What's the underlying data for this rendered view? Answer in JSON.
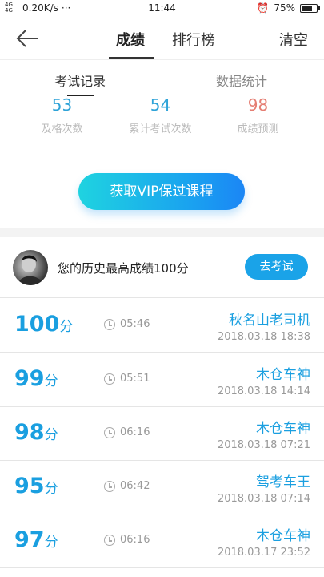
{
  "status_bar": {
    "signal": "4G 4G",
    "speed": "0.20K/s",
    "dots": "···",
    "time": "11:44",
    "battery": "75%",
    "battery_level": 0.75
  },
  "nav": {
    "tab_score": "成绩",
    "tab_ranking": "排行榜",
    "clear": "清空"
  },
  "subtabs": {
    "records": "考试记录",
    "stats": "数据统计"
  },
  "stats": [
    {
      "value": "53",
      "label": "及格次数",
      "color": "#2ea3d8"
    },
    {
      "value": "54",
      "label": "累计考试次数",
      "color": "#2ea3d8"
    },
    {
      "value": "98",
      "label": "成绩预测",
      "color": "#e57e73"
    }
  ],
  "vip_button": "获取VIP保过课程",
  "best": {
    "text": "您的历史最高成绩100分",
    "button": "去考试"
  },
  "records": [
    {
      "score": "100",
      "unit": "分",
      "duration": "05:46",
      "name": "秋名山老司机",
      "date": "2018.03.18  18:38"
    },
    {
      "score": "99",
      "unit": "分",
      "duration": "05:51",
      "name": "木仓车神",
      "date": "2018.03.18  14:14"
    },
    {
      "score": "98",
      "unit": "分",
      "duration": "06:16",
      "name": "木仓车神",
      "date": "2018.03.18  07:21"
    },
    {
      "score": "95",
      "unit": "分",
      "duration": "06:42",
      "name": "驾考车王",
      "date": "2018.03.18  07:14"
    },
    {
      "score": "97",
      "unit": "分",
      "duration": "06:16",
      "name": "木仓车神",
      "date": "2018.03.17  23:52"
    }
  ]
}
